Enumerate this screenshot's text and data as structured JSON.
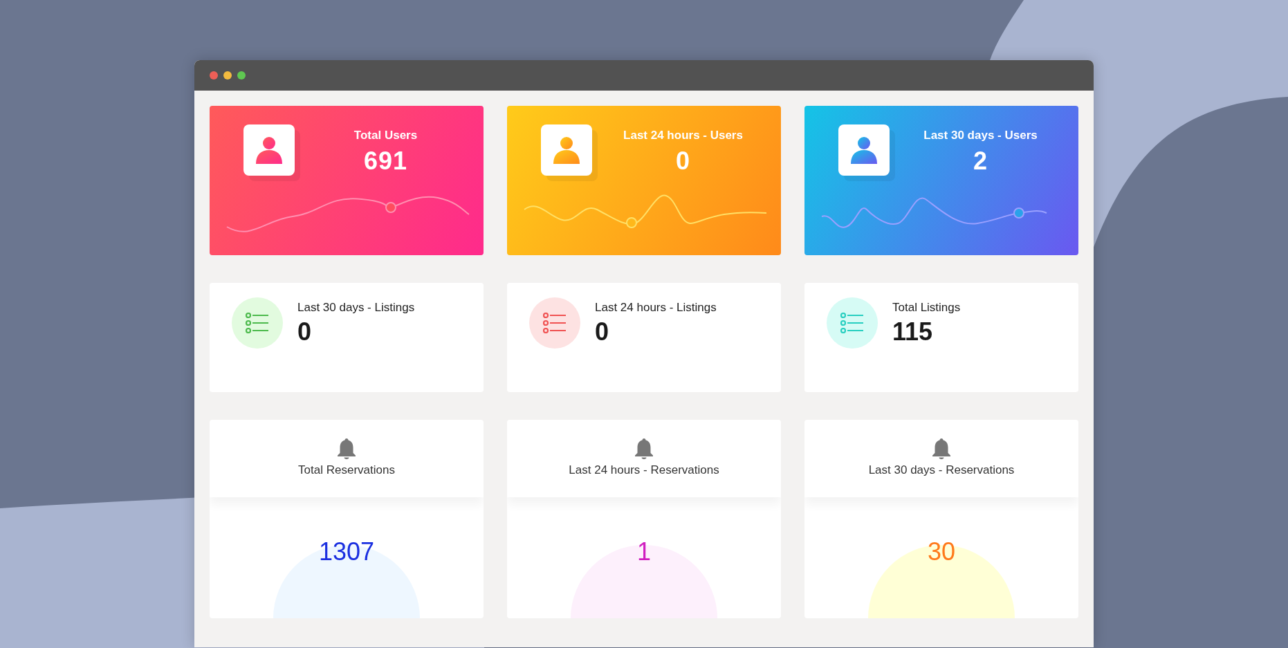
{
  "user_stats": [
    {
      "label": "Total Users",
      "value": "691"
    },
    {
      "label": "Last 24 hours - Users",
      "value": "0"
    },
    {
      "label": "Last 30 days - Users",
      "value": "2"
    }
  ],
  "listing_stats": [
    {
      "label": "Last 30 days - Listings",
      "value": "0"
    },
    {
      "label": "Last 24 hours - Listings",
      "value": "0"
    },
    {
      "label": "Total Listings",
      "value": "115"
    }
  ],
  "reservation_stats": [
    {
      "label": "Total Reservations",
      "value": "1307"
    },
    {
      "label": "Last 24 hours - Reservations",
      "value": "1"
    },
    {
      "label": "Last 30 days - Reservations",
      "value": "30"
    }
  ]
}
